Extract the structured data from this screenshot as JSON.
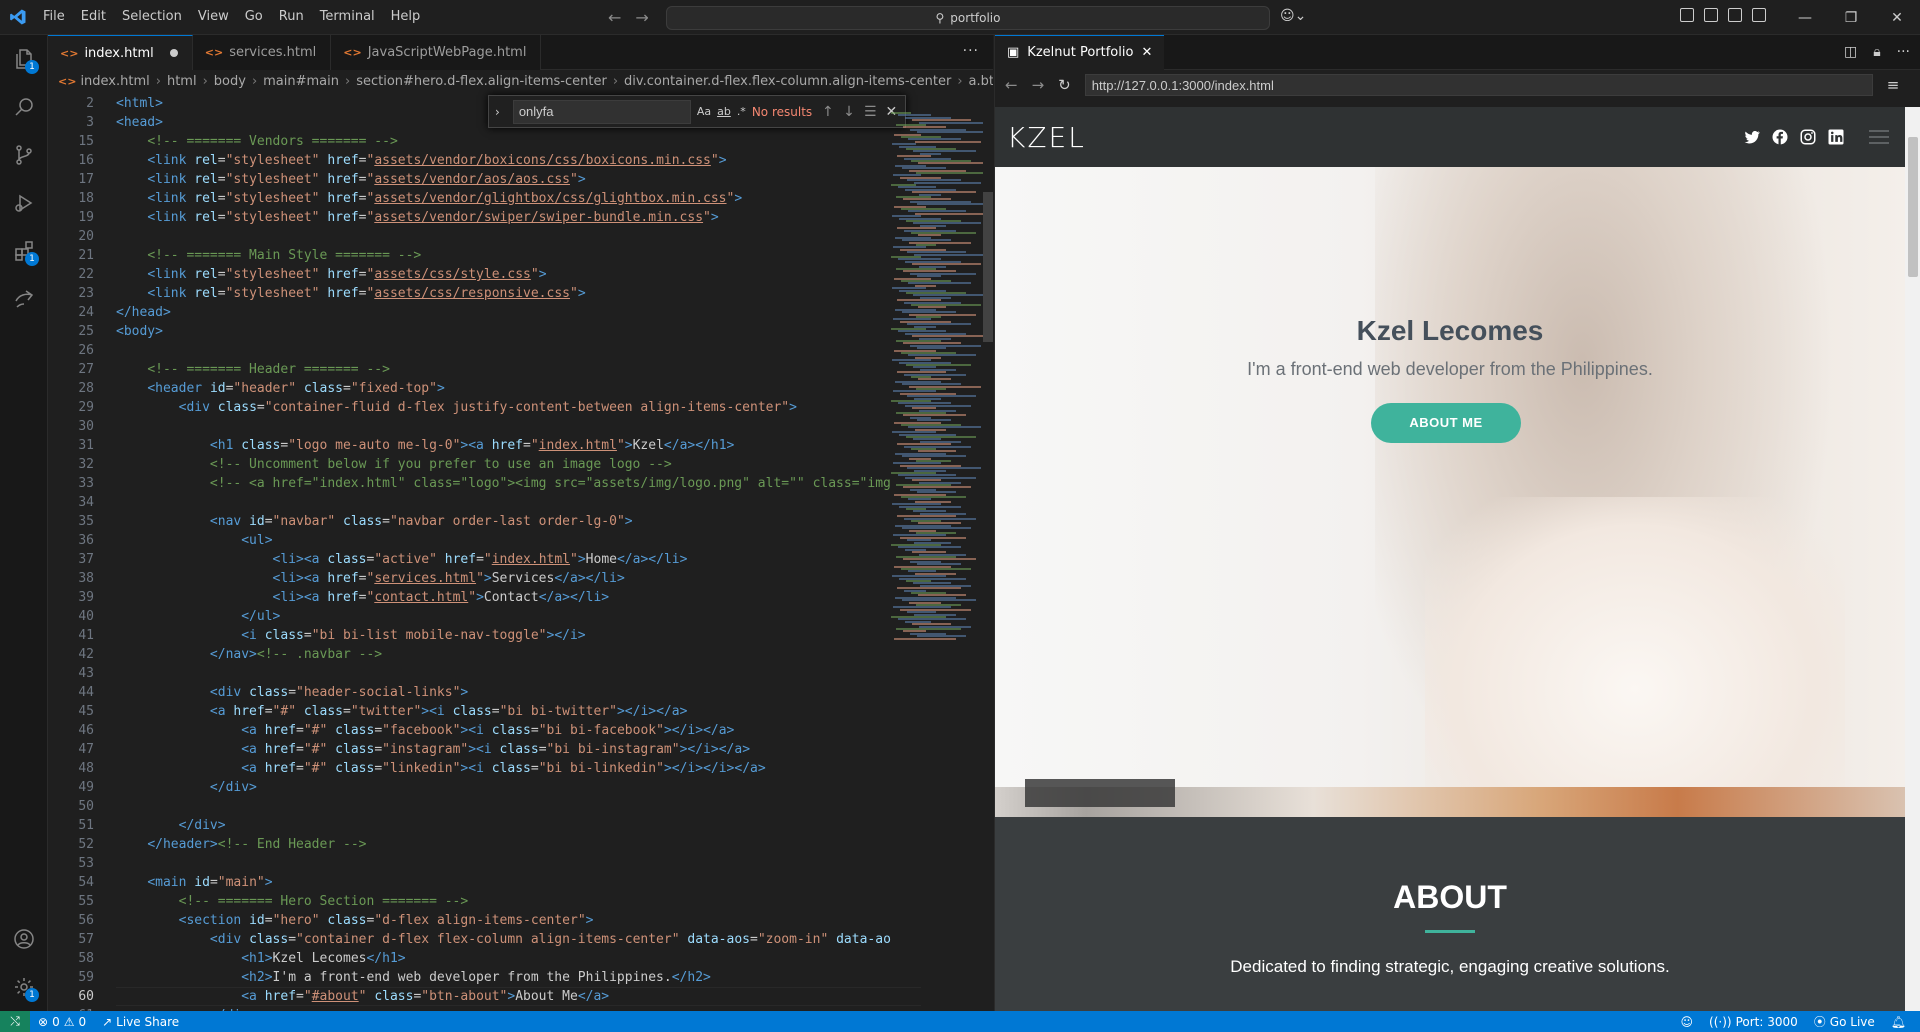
{
  "menu": [
    "File",
    "Edit",
    "Selection",
    "View",
    "Go",
    "Run",
    "Terminal",
    "Help"
  ],
  "command_center": "portfolio",
  "activity_badges": {
    "explorer": "1",
    "extensions": "1",
    "settings": "1"
  },
  "editor": {
    "tabs": [
      {
        "label": "index.html",
        "active": true,
        "modified": true
      },
      {
        "label": "services.html",
        "active": false
      },
      {
        "label": "JavaScriptWebPage.html",
        "active": false
      }
    ],
    "breadcrumbs": [
      "index.html",
      "html",
      "body",
      "main#main",
      "section#hero.d-flex.align-items-center",
      "div.container.d-flex.flex-column.align-items-center",
      "a.bt"
    ],
    "find": {
      "query": "onlyfa",
      "result": "No results",
      "opt_case": "Aa",
      "opt_word": "ab",
      "opt_regex": ".*"
    },
    "current_line": "60",
    "lines": [
      {
        "n": "2",
        "html": "<span class='t'>&lt;html&gt;</span>"
      },
      {
        "n": "3",
        "html": "<span class='t'>&lt;head&gt;</span>"
      },
      {
        "n": "15",
        "html": "    <span class='c'>&lt;!-- ======= Vendors ======= --&gt;</span>"
      },
      {
        "n": "16",
        "html": "    <span class='t'>&lt;link</span> <span class='a'>rel</span>=<span class='s'>\"stylesheet\"</span> <span class='a'>href</span>=<span class='s'>\"<span class='u'>assets/vendor/boxicons/css/boxicons.min.css</span>\"</span><span class='t'>&gt;</span>"
      },
      {
        "n": "17",
        "html": "    <span class='t'>&lt;link</span> <span class='a'>rel</span>=<span class='s'>\"stylesheet\"</span> <span class='a'>href</span>=<span class='s'>\"<span class='u'>assets/vendor/aos/aos.css</span>\"</span><span class='t'>&gt;</span>"
      },
      {
        "n": "18",
        "html": "    <span class='t'>&lt;link</span> <span class='a'>rel</span>=<span class='s'>\"stylesheet\"</span> <span class='a'>href</span>=<span class='s'>\"<span class='u'>assets/vendor/glightbox/css/glightbox.min.css</span>\"</span><span class='t'>&gt;</span>"
      },
      {
        "n": "19",
        "html": "    <span class='t'>&lt;link</span> <span class='a'>rel</span>=<span class='s'>\"stylesheet\"</span> <span class='a'>href</span>=<span class='s'>\"<span class='u'>assets/vendor/swiper/swiper-bundle.min.css</span>\"</span><span class='t'>&gt;</span>"
      },
      {
        "n": "20",
        "html": ""
      },
      {
        "n": "21",
        "html": "    <span class='c'>&lt;!-- ======= Main Style ======= --&gt;</span>"
      },
      {
        "n": "22",
        "html": "    <span class='t'>&lt;link</span> <span class='a'>rel</span>=<span class='s'>\"stylesheet\"</span> <span class='a'>href</span>=<span class='s'>\"<span class='u'>assets/css/style.css</span>\"</span><span class='t'>&gt;</span>"
      },
      {
        "n": "23",
        "html": "    <span class='t'>&lt;link</span> <span class='a'>rel</span>=<span class='s'>\"stylesheet\"</span> <span class='a'>href</span>=<span class='s'>\"<span class='u'>assets/css/responsive.css</span>\"</span><span class='t'>&gt;</span>"
      },
      {
        "n": "24",
        "html": "<span class='t'>&lt;/head&gt;</span>"
      },
      {
        "n": "25",
        "html": "<span class='t'>&lt;body&gt;</span>"
      },
      {
        "n": "26",
        "html": ""
      },
      {
        "n": "27",
        "html": "    <span class='c'>&lt;!-- ======= Header ======= --&gt;</span>"
      },
      {
        "n": "28",
        "html": "    <span class='t'>&lt;header</span> <span class='a'>id</span>=<span class='s'>\"header\"</span> <span class='a'>class</span>=<span class='s'>\"fixed-top\"</span><span class='t'>&gt;</span>"
      },
      {
        "n": "29",
        "html": "        <span class='t'>&lt;div</span> <span class='a'>class</span>=<span class='s'>\"container-fluid d-flex justify-content-between align-items-center\"</span><span class='t'>&gt;</span>"
      },
      {
        "n": "30",
        "html": ""
      },
      {
        "n": "31",
        "html": "            <span class='t'>&lt;h1</span> <span class='a'>class</span>=<span class='s'>\"logo me-auto me-lg-0\"</span><span class='t'>&gt;&lt;a</span> <span class='a'>href</span>=<span class='s'>\"<span class='u'>index.html</span>\"</span><span class='t'>&gt;</span><span class='tx'>Kzel</span><span class='t'>&lt;/a&gt;&lt;/h1&gt;</span>"
      },
      {
        "n": "32",
        "html": "            <span class='c'>&lt;!-- Uncomment below if you prefer to use an image logo --&gt;</span>"
      },
      {
        "n": "33",
        "html": "            <span class='c'>&lt;!-- &lt;a href=\"index.html\" class=\"logo\"&gt;&lt;img src=\"assets/img/logo.png\" alt=\"\" class=\"img</span>"
      },
      {
        "n": "34",
        "html": ""
      },
      {
        "n": "35",
        "html": "            <span class='t'>&lt;nav</span> <span class='a'>id</span>=<span class='s'>\"navbar\"</span> <span class='a'>class</span>=<span class='s'>\"navbar order-last order-lg-0\"</span><span class='t'>&gt;</span>"
      },
      {
        "n": "36",
        "html": "                <span class='t'>&lt;ul&gt;</span>"
      },
      {
        "n": "37",
        "html": "                    <span class='t'>&lt;li&gt;&lt;a</span> <span class='a'>class</span>=<span class='s'>\"active\"</span> <span class='a'>href</span>=<span class='s'>\"<span class='u'>index.html</span>\"</span><span class='t'>&gt;</span><span class='tx'>Home</span><span class='t'>&lt;/a&gt;&lt;/li&gt;</span>"
      },
      {
        "n": "38",
        "html": "                    <span class='t'>&lt;li&gt;&lt;a</span> <span class='a'>href</span>=<span class='s'>\"<span class='u'>services.html</span>\"</span><span class='t'>&gt;</span><span class='tx'>Services</span><span class='t'>&lt;/a&gt;&lt;/li&gt;</span>"
      },
      {
        "n": "39",
        "html": "                    <span class='t'>&lt;li&gt;&lt;a</span> <span class='a'>href</span>=<span class='s'>\"<span class='u'>contact.html</span>\"</span><span class='t'>&gt;</span><span class='tx'>Contact</span><span class='t'>&lt;/a&gt;&lt;/li&gt;</span>"
      },
      {
        "n": "40",
        "html": "                <span class='t'>&lt;/ul&gt;</span>"
      },
      {
        "n": "41",
        "html": "                <span class='t'>&lt;i</span> <span class='a'>class</span>=<span class='s'>\"bi bi-list mobile-nav-toggle\"</span><span class='t'>&gt;&lt;/i&gt;</span>"
      },
      {
        "n": "42",
        "html": "            <span class='t'>&lt;/nav&gt;</span><span class='c'>&lt;!-- .navbar --&gt;</span>"
      },
      {
        "n": "43",
        "html": ""
      },
      {
        "n": "44",
        "html": "            <span class='t'>&lt;div</span> <span class='a'>class</span>=<span class='s'>\"header-social-links\"</span><span class='t'>&gt;</span>"
      },
      {
        "n": "45",
        "html": "            <span class='t'>&lt;a</span> <span class='a'>href</span>=<span class='s'>\"#\"</span> <span class='a'>class</span>=<span class='s'>\"twitter\"</span><span class='t'>&gt;&lt;i</span> <span class='a'>class</span>=<span class='s'>\"bi bi-twitter\"</span><span class='t'>&gt;&lt;/i&gt;&lt;/a&gt;</span>"
      },
      {
        "n": "46",
        "html": "                <span class='t'>&lt;a</span> <span class='a'>href</span>=<span class='s'>\"#\"</span> <span class='a'>class</span>=<span class='s'>\"facebook\"</span><span class='t'>&gt;&lt;i</span> <span class='a'>class</span>=<span class='s'>\"bi bi-facebook\"</span><span class='t'>&gt;&lt;/i&gt;&lt;/a&gt;</span>"
      },
      {
        "n": "47",
        "html": "                <span class='t'>&lt;a</span> <span class='a'>href</span>=<span class='s'>\"#\"</span> <span class='a'>class</span>=<span class='s'>\"instagram\"</span><span class='t'>&gt;&lt;i</span> <span class='a'>class</span>=<span class='s'>\"bi bi-instagram\"</span><span class='t'>&gt;&lt;/i&gt;&lt;/a&gt;</span>"
      },
      {
        "n": "48",
        "html": "                <span class='t'>&lt;a</span> <span class='a'>href</span>=<span class='s'>\"#\"</span> <span class='a'>class</span>=<span class='s'>\"linkedin\"</span><span class='t'>&gt;&lt;i</span> <span class='a'>class</span>=<span class='s'>\"bi bi-linkedin\"</span><span class='t'>&gt;&lt;/i&gt;&lt;/i&gt;&lt;/a&gt;</span>"
      },
      {
        "n": "49",
        "html": "            <span class='t'>&lt;/div&gt;</span>"
      },
      {
        "n": "50",
        "html": ""
      },
      {
        "n": "51",
        "html": "        <span class='t'>&lt;/div&gt;</span>"
      },
      {
        "n": "52",
        "html": "    <span class='t'>&lt;/header&gt;</span><span class='c'>&lt;!-- End Header --&gt;</span>"
      },
      {
        "n": "53",
        "html": ""
      },
      {
        "n": "54",
        "html": "    <span class='t'>&lt;main</span> <span class='a'>id</span>=<span class='s'>\"main\"</span><span class='t'>&gt;</span>"
      },
      {
        "n": "55",
        "html": "        <span class='c'>&lt;!-- ======= Hero Section ======= --&gt;</span>"
      },
      {
        "n": "56",
        "html": "        <span class='t'>&lt;section</span> <span class='a'>id</span>=<span class='s'>\"hero\"</span> <span class='a'>class</span>=<span class='s'>\"d-flex align-items-center\"</span><span class='t'>&gt;</span>"
      },
      {
        "n": "57",
        "html": "            <span class='t'>&lt;div</span> <span class='a'>class</span>=<span class='s'>\"container d-flex flex-column align-items-center\"</span> <span class='a'>data-aos</span>=<span class='s'>\"zoom-in\"</span> <span class='a'>data-ao</span>"
      },
      {
        "n": "58",
        "html": "                <span class='t'>&lt;h1&gt;</span><span class='tx'>Kzel Lecomes</span><span class='t'>&lt;/h1&gt;</span>"
      },
      {
        "n": "59",
        "html": "                <span class='t'>&lt;h2&gt;</span><span class='tx'>I'm a front-end web developer from the Philippines.</span><span class='t'>&lt;/h2&gt;</span>"
      },
      {
        "n": "60",
        "html": "                <span class='t'>&lt;a</span> <span class='a'>href</span>=<span class='s'>\"<span class='u'>#about</span>\"</span> <span class='a'>class</span>=<span class='s'>\"btn-about\"</span><span class='t'>&gt;</span><span class='tx'>About Me</span><span class='t'>&lt;/a&gt;</span>"
      },
      {
        "n": "61",
        "html": "            <span class='t'>&lt;/div&gt;</span>"
      }
    ]
  },
  "preview": {
    "tab_label": "Kzelnut Portfolio",
    "url": "http://127.0.0.1:3000/index.html",
    "site": {
      "logo": "KZEL",
      "hero_title": "Kzel Lecomes",
      "hero_subtitle": "I'm a front-end web developer from the Philippines.",
      "hero_button": "ABOUT ME",
      "about_title": "ABOUT",
      "about_text": "Dedicated to finding strategic, engaging creative solutions."
    }
  },
  "status": {
    "errors": "0",
    "warnings": "0",
    "live_share": "Live Share",
    "port": "Port: 3000",
    "go_live": "Go Live"
  },
  "colors": {
    "accent": "#0078d4",
    "teal": "#3fb39c",
    "status_bar": "#0078d4"
  }
}
